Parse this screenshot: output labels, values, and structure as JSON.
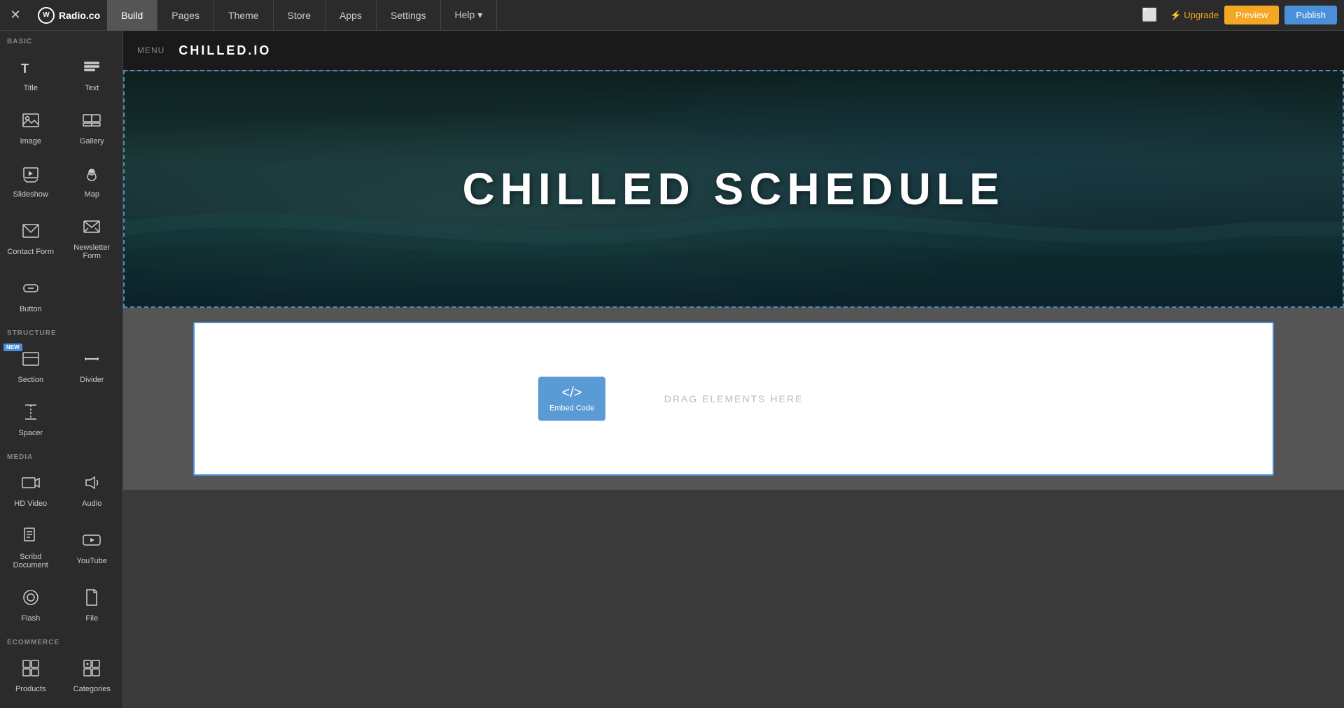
{
  "nav": {
    "close_icon": "✕",
    "logo_icon": "W",
    "logo_text": "Radio.co",
    "tabs": [
      {
        "label": "Build",
        "active": true
      },
      {
        "label": "Pages",
        "active": false
      },
      {
        "label": "Theme",
        "active": false
      },
      {
        "label": "Store",
        "active": false
      },
      {
        "label": "Apps",
        "active": false
      },
      {
        "label": "Settings",
        "active": false
      },
      {
        "label": "Help ▾",
        "active": false
      }
    ],
    "device_icon": "⬜",
    "upgrade_label": "⚡ Upgrade",
    "preview_label": "Preview",
    "publish_label": "Publish"
  },
  "sidebar": {
    "sections": [
      {
        "label": "Basic",
        "items": [
          {
            "name": "Title",
            "icon": "title"
          },
          {
            "name": "Text",
            "icon": "text"
          },
          {
            "name": "Image",
            "icon": "image"
          },
          {
            "name": "Gallery",
            "icon": "gallery"
          },
          {
            "name": "Slideshow",
            "icon": "slideshow"
          },
          {
            "name": "Map",
            "icon": "map"
          },
          {
            "name": "Contact Form",
            "icon": "contact-form"
          },
          {
            "name": "Newsletter Form",
            "icon": "newsletter"
          },
          {
            "name": "Button",
            "icon": "button"
          }
        ]
      },
      {
        "label": "Structure",
        "items": [
          {
            "name": "Section",
            "icon": "section",
            "badge": "NEW"
          },
          {
            "name": "Divider",
            "icon": "divider"
          },
          {
            "name": "Spacer",
            "icon": "spacer"
          }
        ]
      },
      {
        "label": "Media",
        "items": [
          {
            "name": "HD Video",
            "icon": "hd-video"
          },
          {
            "name": "Audio",
            "icon": "audio"
          },
          {
            "name": "Scribd Document",
            "icon": "scribd"
          },
          {
            "name": "YouTube",
            "icon": "youtube"
          },
          {
            "name": "Flash",
            "icon": "flash"
          },
          {
            "name": "File",
            "icon": "file"
          }
        ]
      },
      {
        "label": "Ecommerce",
        "items": [
          {
            "name": "Products",
            "icon": "products"
          },
          {
            "name": "Categories",
            "icon": "categories"
          }
        ]
      }
    ]
  },
  "site_header": {
    "menu_label": "MENU",
    "site_title": "CHILLED.IO"
  },
  "hero": {
    "title": "CHILLED SCHEDULE"
  },
  "drop_zone": {
    "label": "DRAG ELEMENTS HERE",
    "embed_widget": {
      "icon": "</>",
      "label": "Embed Code"
    }
  }
}
